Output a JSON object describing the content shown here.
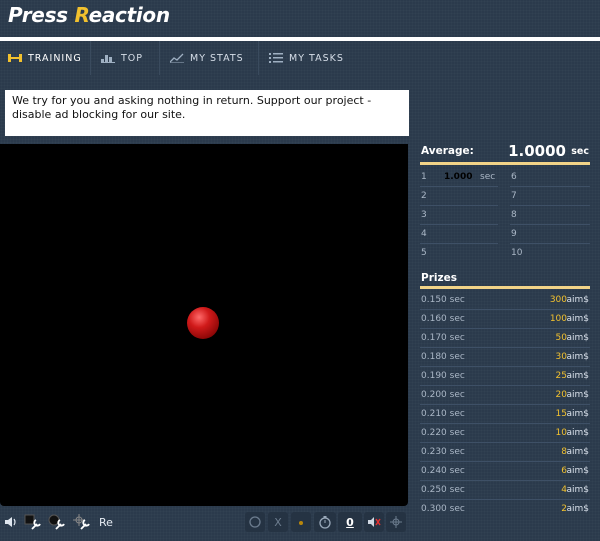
{
  "app": {
    "logo_part1": "Press ",
    "logo_r": "R",
    "logo_part2": "eaction"
  },
  "nav": {
    "training": "TRAINING",
    "top": "TOP",
    "my_stats": "MY STATS",
    "my_tasks": "MY TASKS"
  },
  "ad": {
    "text": "We try for you and asking nothing in return. Support our project - disable ad blocking for our site."
  },
  "toolbar": {
    "re_label": "Re",
    "x_label": "X",
    "count": "0"
  },
  "stats": {
    "average_label": "Average:",
    "average_value": "1.0000",
    "average_unit": "sec",
    "attempts": [
      {
        "n": "1",
        "value": "1.000",
        "unit": "sec"
      },
      {
        "n": "2",
        "value": "",
        "unit": ""
      },
      {
        "n": "3",
        "value": "",
        "unit": ""
      },
      {
        "n": "4",
        "value": "",
        "unit": ""
      },
      {
        "n": "5",
        "value": "",
        "unit": ""
      },
      {
        "n": "6",
        "value": "",
        "unit": ""
      },
      {
        "n": "7",
        "value": "",
        "unit": ""
      },
      {
        "n": "8",
        "value": "",
        "unit": ""
      },
      {
        "n": "9",
        "value": "",
        "unit": ""
      },
      {
        "n": "10",
        "value": "",
        "unit": ""
      }
    ]
  },
  "prizes": {
    "title": "Prizes",
    "currency": "aim$",
    "rows": [
      {
        "time": "0.150 sec",
        "amount": "300"
      },
      {
        "time": "0.160 sec",
        "amount": "100"
      },
      {
        "time": "0.170 sec",
        "amount": "50"
      },
      {
        "time": "0.180 sec",
        "amount": "30"
      },
      {
        "time": "0.190 sec",
        "amount": "25"
      },
      {
        "time": "0.200 sec",
        "amount": "20"
      },
      {
        "time": "0.210 sec",
        "amount": "15"
      },
      {
        "time": "0.220 sec",
        "amount": "10"
      },
      {
        "time": "0.230 sec",
        "amount": "8"
      },
      {
        "time": "0.240 sec",
        "amount": "6"
      },
      {
        "time": "0.250 sec",
        "amount": "4"
      },
      {
        "time": "0.300 sec",
        "amount": "2"
      }
    ]
  },
  "colors": {
    "background": "#2b3a4c",
    "accent": "#f2c12e",
    "divider": "#f2d488",
    "ball": "#d01a1a"
  },
  "icons": {
    "training": "dumbbell-icon",
    "top": "trophy-bars-icon",
    "my_stats": "chart-icon",
    "my_tasks": "list-icon"
  }
}
